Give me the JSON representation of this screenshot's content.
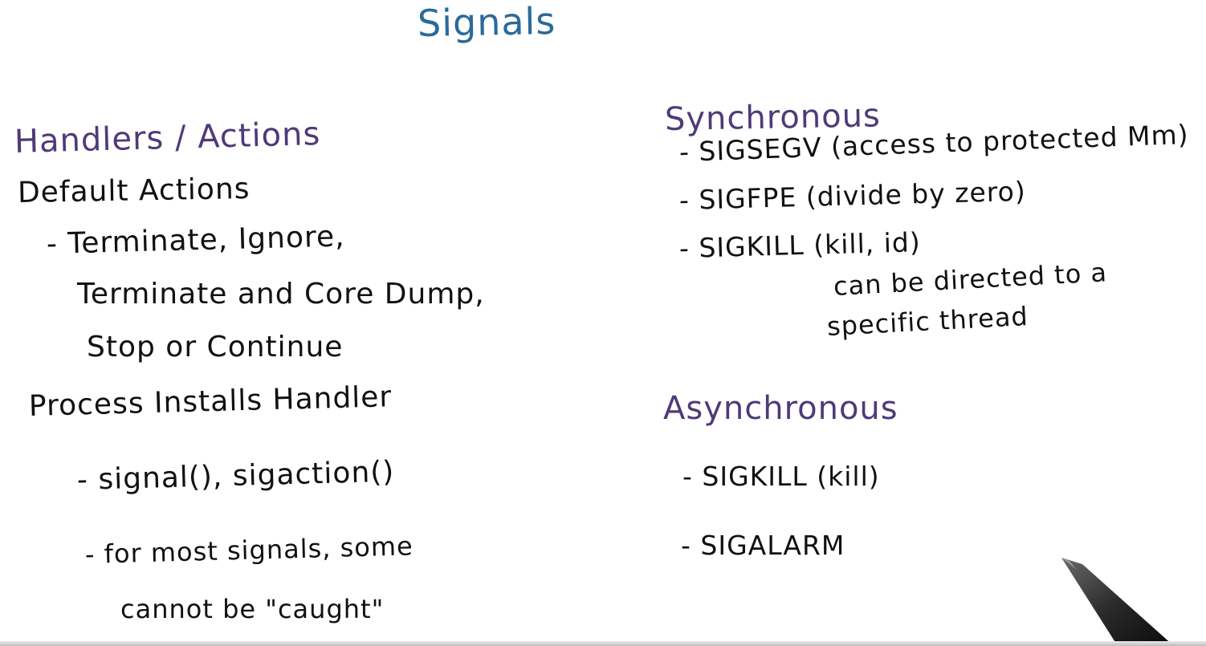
{
  "title": "Signals",
  "left": {
    "heading": "Handlers / Actions",
    "default_actions": {
      "label": "Default Actions",
      "items": [
        "- Terminate, Ignore,",
        "Terminate and Core Dump,",
        "Stop or Continue"
      ]
    },
    "process_installs": {
      "label": "Process Installs Handler",
      "items": [
        "- signal(), sigaction()",
        "- for most signals, some",
        "cannot be \"caught\""
      ]
    }
  },
  "right": {
    "synchronous": {
      "heading": "Synchronous",
      "items": [
        "- SIGSEGV (access to protected Mm)",
        "- SIGFPE (divide by zero)",
        "- SIGKILL (kill, id)"
      ],
      "note": [
        "can be directed to a",
        "specific thread"
      ]
    },
    "asynchronous": {
      "heading": "Asynchronous",
      "items": [
        "- SIGKILL (kill)",
        "- SIGALARM"
      ]
    }
  },
  "colors": {
    "title": "#2a6a9a",
    "heading": "#4f3a78",
    "ink": "#111111",
    "background": "#ffffff"
  },
  "icons": {
    "pen": "pen-icon"
  }
}
